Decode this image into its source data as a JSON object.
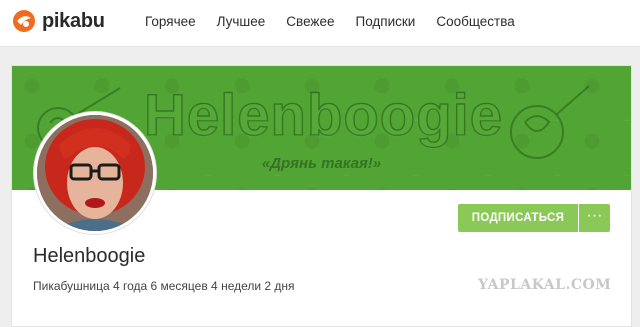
{
  "header": {
    "logo_text": "pikabu",
    "nav": [
      {
        "label": "Горячее"
      },
      {
        "label": "Лучшее"
      },
      {
        "label": "Свежее"
      },
      {
        "label": "Подписки"
      },
      {
        "label": "Сообщества"
      }
    ],
    "brand_color": "#ef6b1f"
  },
  "profile": {
    "cover_title": "Helenboogie",
    "cover_subtitle": "«Дрянь такая!»",
    "cover_color": "#52a534",
    "avatar_icon": "user-avatar",
    "username": "Helenboogie",
    "stats": "Пикабушница 4 года 6 месяцев 4 недели 2 дня",
    "subscribe_label": "ПОДПИСАТЬСЯ",
    "more_label": "···",
    "button_color": "#8ac858"
  },
  "watermark": "YAPLAKAL.COM"
}
